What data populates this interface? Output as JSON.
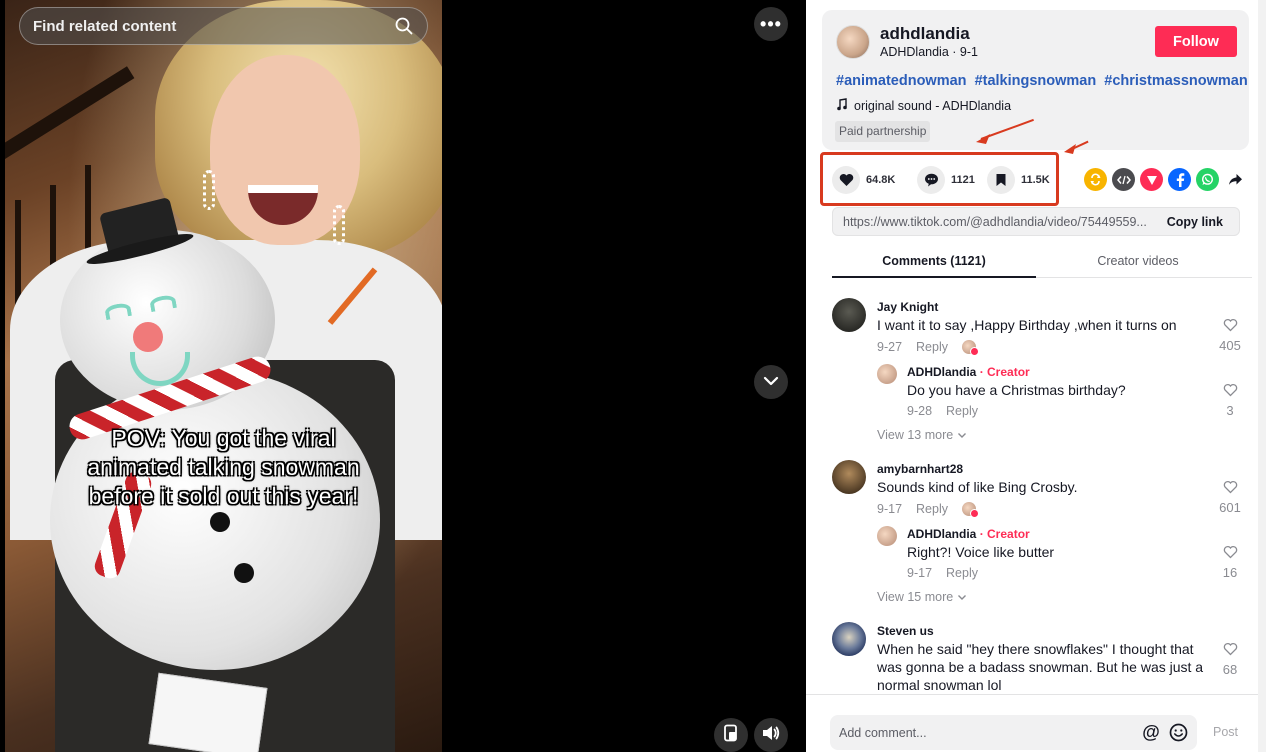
{
  "search": {
    "placeholder": "Find related content"
  },
  "video": {
    "caption_lines": [
      "POV: You got the viral",
      "animated talking snowman",
      "before it sold out this year!"
    ],
    "more_label": "•••"
  },
  "author": {
    "username": "adhdlandia",
    "display_name": "ADHDlandia",
    "date": "9-1",
    "subtitle": "ADHDlandia · 9-1",
    "follow_label": "Follow",
    "hashtags": [
      "#animatednowman",
      "#talkingsnowman",
      "#christmassnowman"
    ],
    "sound": "original sound - ADHDlandia",
    "paid_label": "Paid partnership"
  },
  "actions": {
    "likes": "64.8K",
    "comments": "1121",
    "saves": "11.5K"
  },
  "share_icons": [
    "repost-icon",
    "embed-icon",
    "send-icon",
    "facebook-icon",
    "whatsapp-icon",
    "share-arrow-icon"
  ],
  "link": {
    "url": "https://www.tiktok.com/@adhdlandia/video/75449559...",
    "copy_label": "Copy link"
  },
  "tabs": [
    {
      "label": "Comments (1121)",
      "active": true
    },
    {
      "label": "Creator videos",
      "active": false
    }
  ],
  "comments": [
    {
      "author": "Jay Knight",
      "text": "I want it to say ,Happy Birthday ,when it turns on",
      "date": "9-27",
      "reply_label": "Reply",
      "likes": "405",
      "reply": {
        "author": "ADHDlandia",
        "badge": "· Creator",
        "text": "Do you have a Christmas birthday?",
        "date": "9-28",
        "reply_label": "Reply",
        "likes": "3"
      },
      "view_more": "View 13 more"
    },
    {
      "author": "amybarnhart28",
      "text": "Sounds kind of like Bing Crosby.",
      "date": "9-17",
      "reply_label": "Reply",
      "likes": "601",
      "reply": {
        "author": "ADHDlandia",
        "badge": "· Creator",
        "text": "Right?! Voice like butter",
        "date": "9-17",
        "reply_label": "Reply",
        "likes": "16"
      },
      "view_more": "View 15 more"
    },
    {
      "author": "Steven us",
      "text_lines": [
        "When he said \"hey there snowflakes\" I thought that",
        "was gonna be a badass snowman. But he was just a",
        "normal snowman lol"
      ],
      "likes": "68"
    }
  ],
  "footer": {
    "comment_placeholder": "Add comment...",
    "at_label": "@",
    "post_label": "Post"
  },
  "colors": {
    "follow": "#fe2c55",
    "hashtag": "#2b5db9",
    "highlight": "#d83a1f",
    "creator": "#fe2c55"
  }
}
